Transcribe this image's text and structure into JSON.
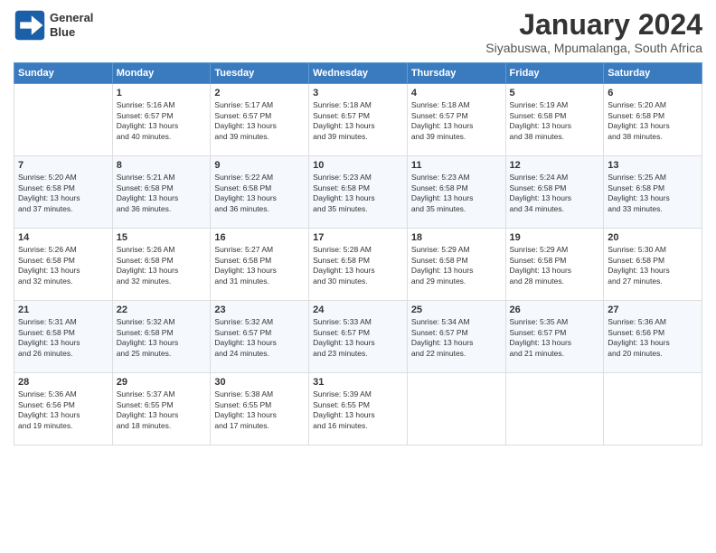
{
  "logo": {
    "line1": "General",
    "line2": "Blue"
  },
  "title": "January 2024",
  "subtitle": "Siyabuswa, Mpumalanga, South Africa",
  "days_of_week": [
    "Sunday",
    "Monday",
    "Tuesday",
    "Wednesday",
    "Thursday",
    "Friday",
    "Saturday"
  ],
  "weeks": [
    [
      {
        "num": "",
        "text": ""
      },
      {
        "num": "1",
        "text": "Sunrise: 5:16 AM\nSunset: 6:57 PM\nDaylight: 13 hours\nand 40 minutes."
      },
      {
        "num": "2",
        "text": "Sunrise: 5:17 AM\nSunset: 6:57 PM\nDaylight: 13 hours\nand 39 minutes."
      },
      {
        "num": "3",
        "text": "Sunrise: 5:18 AM\nSunset: 6:57 PM\nDaylight: 13 hours\nand 39 minutes."
      },
      {
        "num": "4",
        "text": "Sunrise: 5:18 AM\nSunset: 6:57 PM\nDaylight: 13 hours\nand 39 minutes."
      },
      {
        "num": "5",
        "text": "Sunrise: 5:19 AM\nSunset: 6:58 PM\nDaylight: 13 hours\nand 38 minutes."
      },
      {
        "num": "6",
        "text": "Sunrise: 5:20 AM\nSunset: 6:58 PM\nDaylight: 13 hours\nand 38 minutes."
      }
    ],
    [
      {
        "num": "7",
        "text": "Sunrise: 5:20 AM\nSunset: 6:58 PM\nDaylight: 13 hours\nand 37 minutes."
      },
      {
        "num": "8",
        "text": "Sunrise: 5:21 AM\nSunset: 6:58 PM\nDaylight: 13 hours\nand 36 minutes."
      },
      {
        "num": "9",
        "text": "Sunrise: 5:22 AM\nSunset: 6:58 PM\nDaylight: 13 hours\nand 36 minutes."
      },
      {
        "num": "10",
        "text": "Sunrise: 5:23 AM\nSunset: 6:58 PM\nDaylight: 13 hours\nand 35 minutes."
      },
      {
        "num": "11",
        "text": "Sunrise: 5:23 AM\nSunset: 6:58 PM\nDaylight: 13 hours\nand 35 minutes."
      },
      {
        "num": "12",
        "text": "Sunrise: 5:24 AM\nSunset: 6:58 PM\nDaylight: 13 hours\nand 34 minutes."
      },
      {
        "num": "13",
        "text": "Sunrise: 5:25 AM\nSunset: 6:58 PM\nDaylight: 13 hours\nand 33 minutes."
      }
    ],
    [
      {
        "num": "14",
        "text": "Sunrise: 5:26 AM\nSunset: 6:58 PM\nDaylight: 13 hours\nand 32 minutes."
      },
      {
        "num": "15",
        "text": "Sunrise: 5:26 AM\nSunset: 6:58 PM\nDaylight: 13 hours\nand 32 minutes."
      },
      {
        "num": "16",
        "text": "Sunrise: 5:27 AM\nSunset: 6:58 PM\nDaylight: 13 hours\nand 31 minutes."
      },
      {
        "num": "17",
        "text": "Sunrise: 5:28 AM\nSunset: 6:58 PM\nDaylight: 13 hours\nand 30 minutes."
      },
      {
        "num": "18",
        "text": "Sunrise: 5:29 AM\nSunset: 6:58 PM\nDaylight: 13 hours\nand 29 minutes."
      },
      {
        "num": "19",
        "text": "Sunrise: 5:29 AM\nSunset: 6:58 PM\nDaylight: 13 hours\nand 28 minutes."
      },
      {
        "num": "20",
        "text": "Sunrise: 5:30 AM\nSunset: 6:58 PM\nDaylight: 13 hours\nand 27 minutes."
      }
    ],
    [
      {
        "num": "21",
        "text": "Sunrise: 5:31 AM\nSunset: 6:58 PM\nDaylight: 13 hours\nand 26 minutes."
      },
      {
        "num": "22",
        "text": "Sunrise: 5:32 AM\nSunset: 6:58 PM\nDaylight: 13 hours\nand 25 minutes."
      },
      {
        "num": "23",
        "text": "Sunrise: 5:32 AM\nSunset: 6:57 PM\nDaylight: 13 hours\nand 24 minutes."
      },
      {
        "num": "24",
        "text": "Sunrise: 5:33 AM\nSunset: 6:57 PM\nDaylight: 13 hours\nand 23 minutes."
      },
      {
        "num": "25",
        "text": "Sunrise: 5:34 AM\nSunset: 6:57 PM\nDaylight: 13 hours\nand 22 minutes."
      },
      {
        "num": "26",
        "text": "Sunrise: 5:35 AM\nSunset: 6:57 PM\nDaylight: 13 hours\nand 21 minutes."
      },
      {
        "num": "27",
        "text": "Sunrise: 5:36 AM\nSunset: 6:56 PM\nDaylight: 13 hours\nand 20 minutes."
      }
    ],
    [
      {
        "num": "28",
        "text": "Sunrise: 5:36 AM\nSunset: 6:56 PM\nDaylight: 13 hours\nand 19 minutes."
      },
      {
        "num": "29",
        "text": "Sunrise: 5:37 AM\nSunset: 6:55 PM\nDaylight: 13 hours\nand 18 minutes."
      },
      {
        "num": "30",
        "text": "Sunrise: 5:38 AM\nSunset: 6:55 PM\nDaylight: 13 hours\nand 17 minutes."
      },
      {
        "num": "31",
        "text": "Sunrise: 5:39 AM\nSunset: 6:55 PM\nDaylight: 13 hours\nand 16 minutes."
      },
      {
        "num": "",
        "text": ""
      },
      {
        "num": "",
        "text": ""
      },
      {
        "num": "",
        "text": ""
      }
    ]
  ]
}
